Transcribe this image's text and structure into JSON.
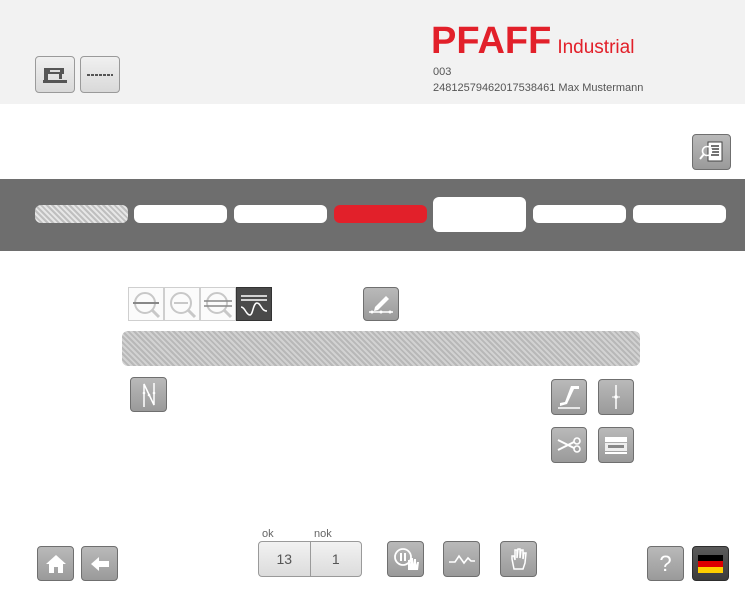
{
  "header": {
    "brand": "PFAFF",
    "brand_suffix": "Industrial",
    "program_number": "003",
    "info_line": "24812579462017538461   Max Mustermann",
    "left_buttons": [
      "sewing-machine-icon",
      "seam-line-icon"
    ]
  },
  "toolbar": {
    "details_button": "magnifier-document-icon"
  },
  "steps": {
    "count": 7,
    "states": [
      "hatched",
      "inactive",
      "inactive",
      "active",
      "selected",
      "inactive",
      "inactive"
    ],
    "active_color": "#e2202a"
  },
  "zoom": {
    "buttons": [
      "zoom-out-icon",
      "zoom-in-icon",
      "zoom-fit-icon",
      "curve-view-icon"
    ],
    "selected": "curve-view-icon"
  },
  "colors": {
    "brand": "#e2202a",
    "step_bar": "#6e6e6e",
    "button": "#a9a9a9"
  },
  "counter": {
    "ok_label": "ok",
    "nok_label": "nok",
    "ok_value": "13",
    "nok_value": "1"
  },
  "footer": {
    "help_label": "?",
    "language": "de-flag-icon"
  }
}
